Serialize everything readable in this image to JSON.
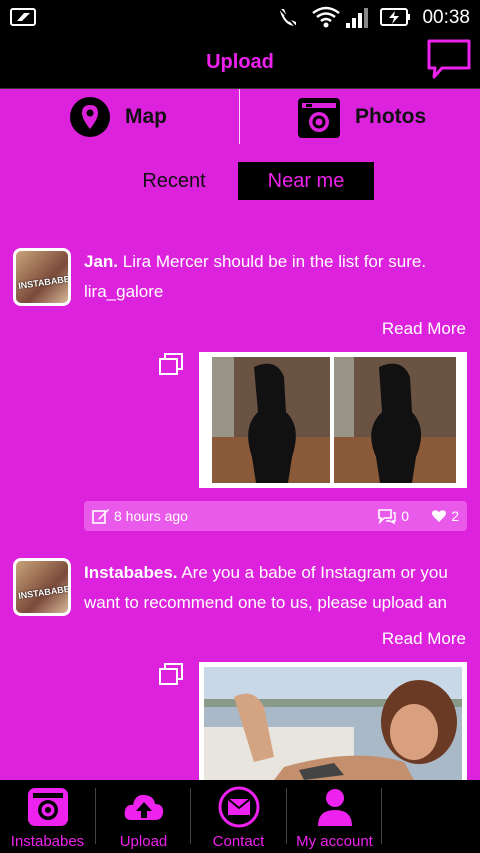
{
  "status_bar": {
    "time": "00:38"
  },
  "app_bar": {
    "title": "Upload"
  },
  "modes": {
    "map_label": "Map",
    "photos_label": "Photos"
  },
  "segments": {
    "recent": "Recent",
    "near_me": "Near me"
  },
  "posts": [
    {
      "avatar_text": "INSTABABES",
      "author": "Jan.",
      "text": " Lira Mercer should be in the list for sure.",
      "text2": "lira_galore",
      "read_more": "Read More",
      "time": "8 hours ago",
      "comments": "0",
      "likes": "2"
    },
    {
      "avatar_text": "INSTABABES",
      "author": "Instababes.",
      "text": " Are you a babe of Instagram or you",
      "text2": "want to recommend one to us, please upload an",
      "read_more": "Read More"
    }
  ],
  "tabs": [
    {
      "label": "Instababes",
      "icon": "camera-icon"
    },
    {
      "label": "Upload",
      "icon": "cloud-upload-icon"
    },
    {
      "label": "Contact",
      "icon": "mail-icon"
    },
    {
      "label": "My account",
      "icon": "user-icon"
    }
  ],
  "colors": {
    "background": "#dd22dd",
    "accent": "#ee22ee",
    "bar": "#000000"
  }
}
